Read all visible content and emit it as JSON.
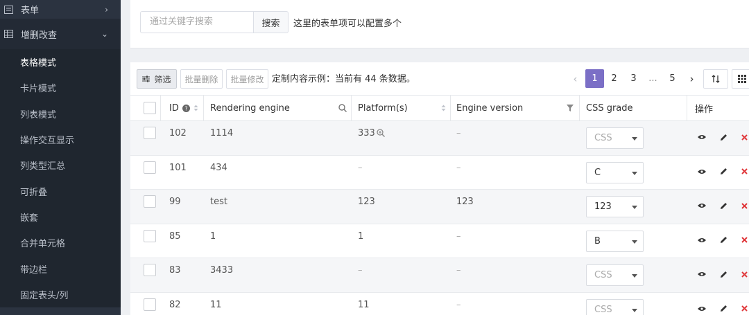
{
  "sidebar": {
    "menu_form": "表单",
    "menu_crud": "增删改查",
    "items": [
      "表格模式",
      "卡片模式",
      "列表模式",
      "操作交互显示",
      "列类型汇总",
      "可折叠",
      "嵌套",
      "合并单元格",
      "带边栏",
      "固定表头/列"
    ]
  },
  "search": {
    "placeholder": "通过关键字搜索",
    "button": "搜索",
    "tip": "这里的表单项可以配置多个"
  },
  "toolbar": {
    "filter": "筛选",
    "batch_delete": "批量删除",
    "batch_edit": "批量修改",
    "info": "定制内容示例：当前有 44 条数据。"
  },
  "pager": {
    "pages": [
      "1",
      "2",
      "3",
      "...",
      "5"
    ],
    "current": "1"
  },
  "table": {
    "headers": {
      "id": "ID",
      "engine": "Rendering engine",
      "platform": "Platform(s)",
      "version": "Engine version",
      "grade": "CSS grade",
      "ops": "操作"
    },
    "rows": [
      {
        "id": "102",
        "engine": "1114",
        "platform": "333",
        "version": "–",
        "grade": "CSS"
      },
      {
        "id": "101",
        "engine": "434",
        "platform": "–",
        "version": "–",
        "grade": "C"
      },
      {
        "id": "99",
        "engine": "test",
        "platform": "123",
        "version": "123",
        "grade": "123"
      },
      {
        "id": "85",
        "engine": "1",
        "platform": "1",
        "version": "–",
        "grade": "B"
      },
      {
        "id": "83",
        "engine": "3433",
        "platform": "–",
        "version": "–",
        "grade": "CSS"
      },
      {
        "id": "82",
        "engine": "11",
        "platform": "11",
        "version": "–",
        "grade": "CSS"
      }
    ]
  },
  "colors": {
    "sidebar_bg": "#2b3340",
    "submenu_bg": "#1f262f",
    "accent": "#7b6fc6",
    "delete": "#e0373a"
  }
}
